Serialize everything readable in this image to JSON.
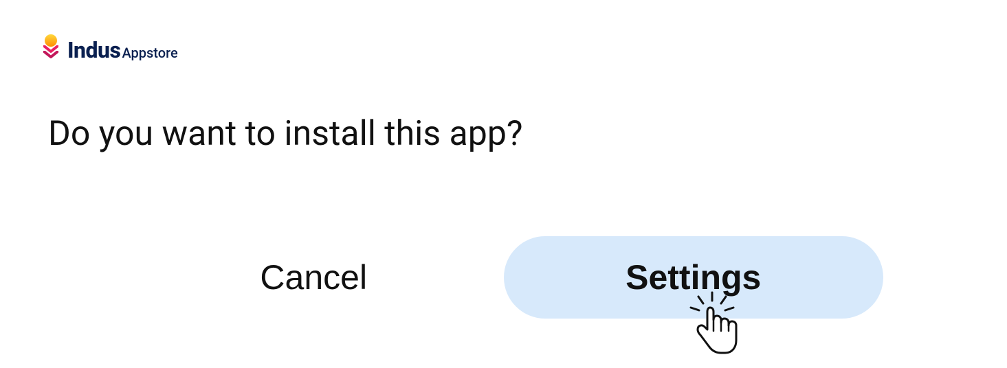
{
  "logo": {
    "brand_primary": "Indus",
    "brand_secondary": "Appstore"
  },
  "dialog": {
    "prompt": "Do you want to install this app?",
    "cancel_label": "Cancel",
    "settings_label": "Settings"
  },
  "colors": {
    "highlight_bg": "#d7e9fb",
    "brand_text": "#0a2050"
  }
}
